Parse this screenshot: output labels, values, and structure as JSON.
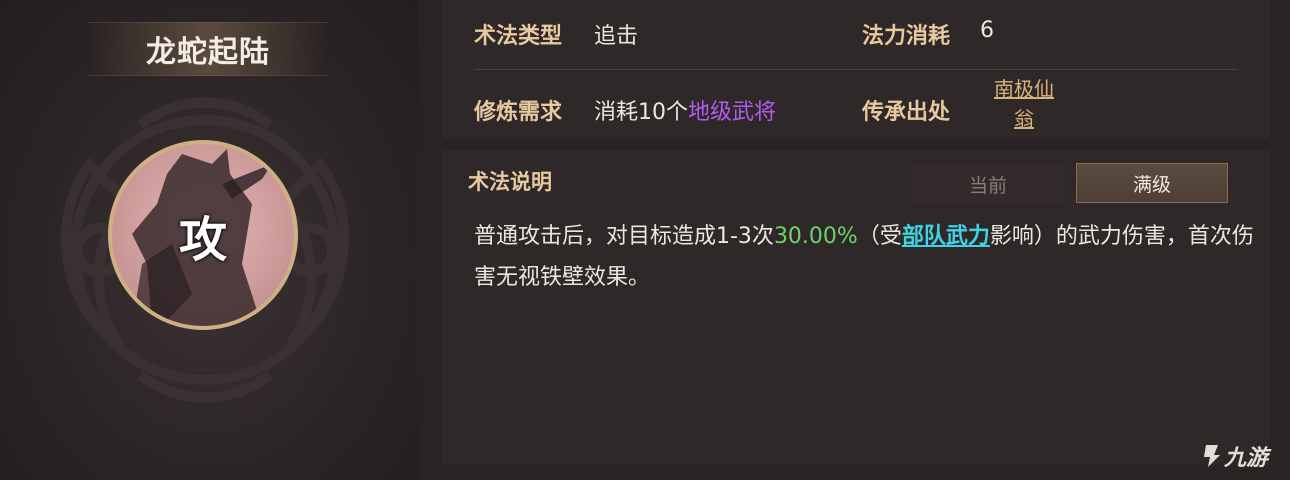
{
  "skill": {
    "name": "龙蛇起陆",
    "icon_char": "攻",
    "icon_color": "#cf9c9c"
  },
  "info": {
    "type_label": "术法类型",
    "type_value": "追击",
    "cost_label": "法力消耗",
    "cost_value": "6",
    "requirement_label": "修炼需求",
    "requirement_prefix": "消耗10个",
    "requirement_highlight": "地级武将",
    "origin_label": "传承出处",
    "origin_value": "南极仙翁"
  },
  "description": {
    "title": "术法说明",
    "tab_current": "当前",
    "tab_max": "满级",
    "segments": {
      "s1": "普通攻击后，对目标造成1-3次",
      "s2": "30.00%",
      "s3": "（受",
      "s4": "部队武力",
      "s5": "影响）的武力伤害，首次伤害无视铁壁效果。"
    }
  },
  "colors": {
    "label_gold": "#e7c9a0",
    "highlight_purple": "#b15bf0",
    "highlight_green": "#6ed36a",
    "highlight_cyan": "#3fd3e6"
  },
  "watermark": {
    "text": "九游"
  }
}
